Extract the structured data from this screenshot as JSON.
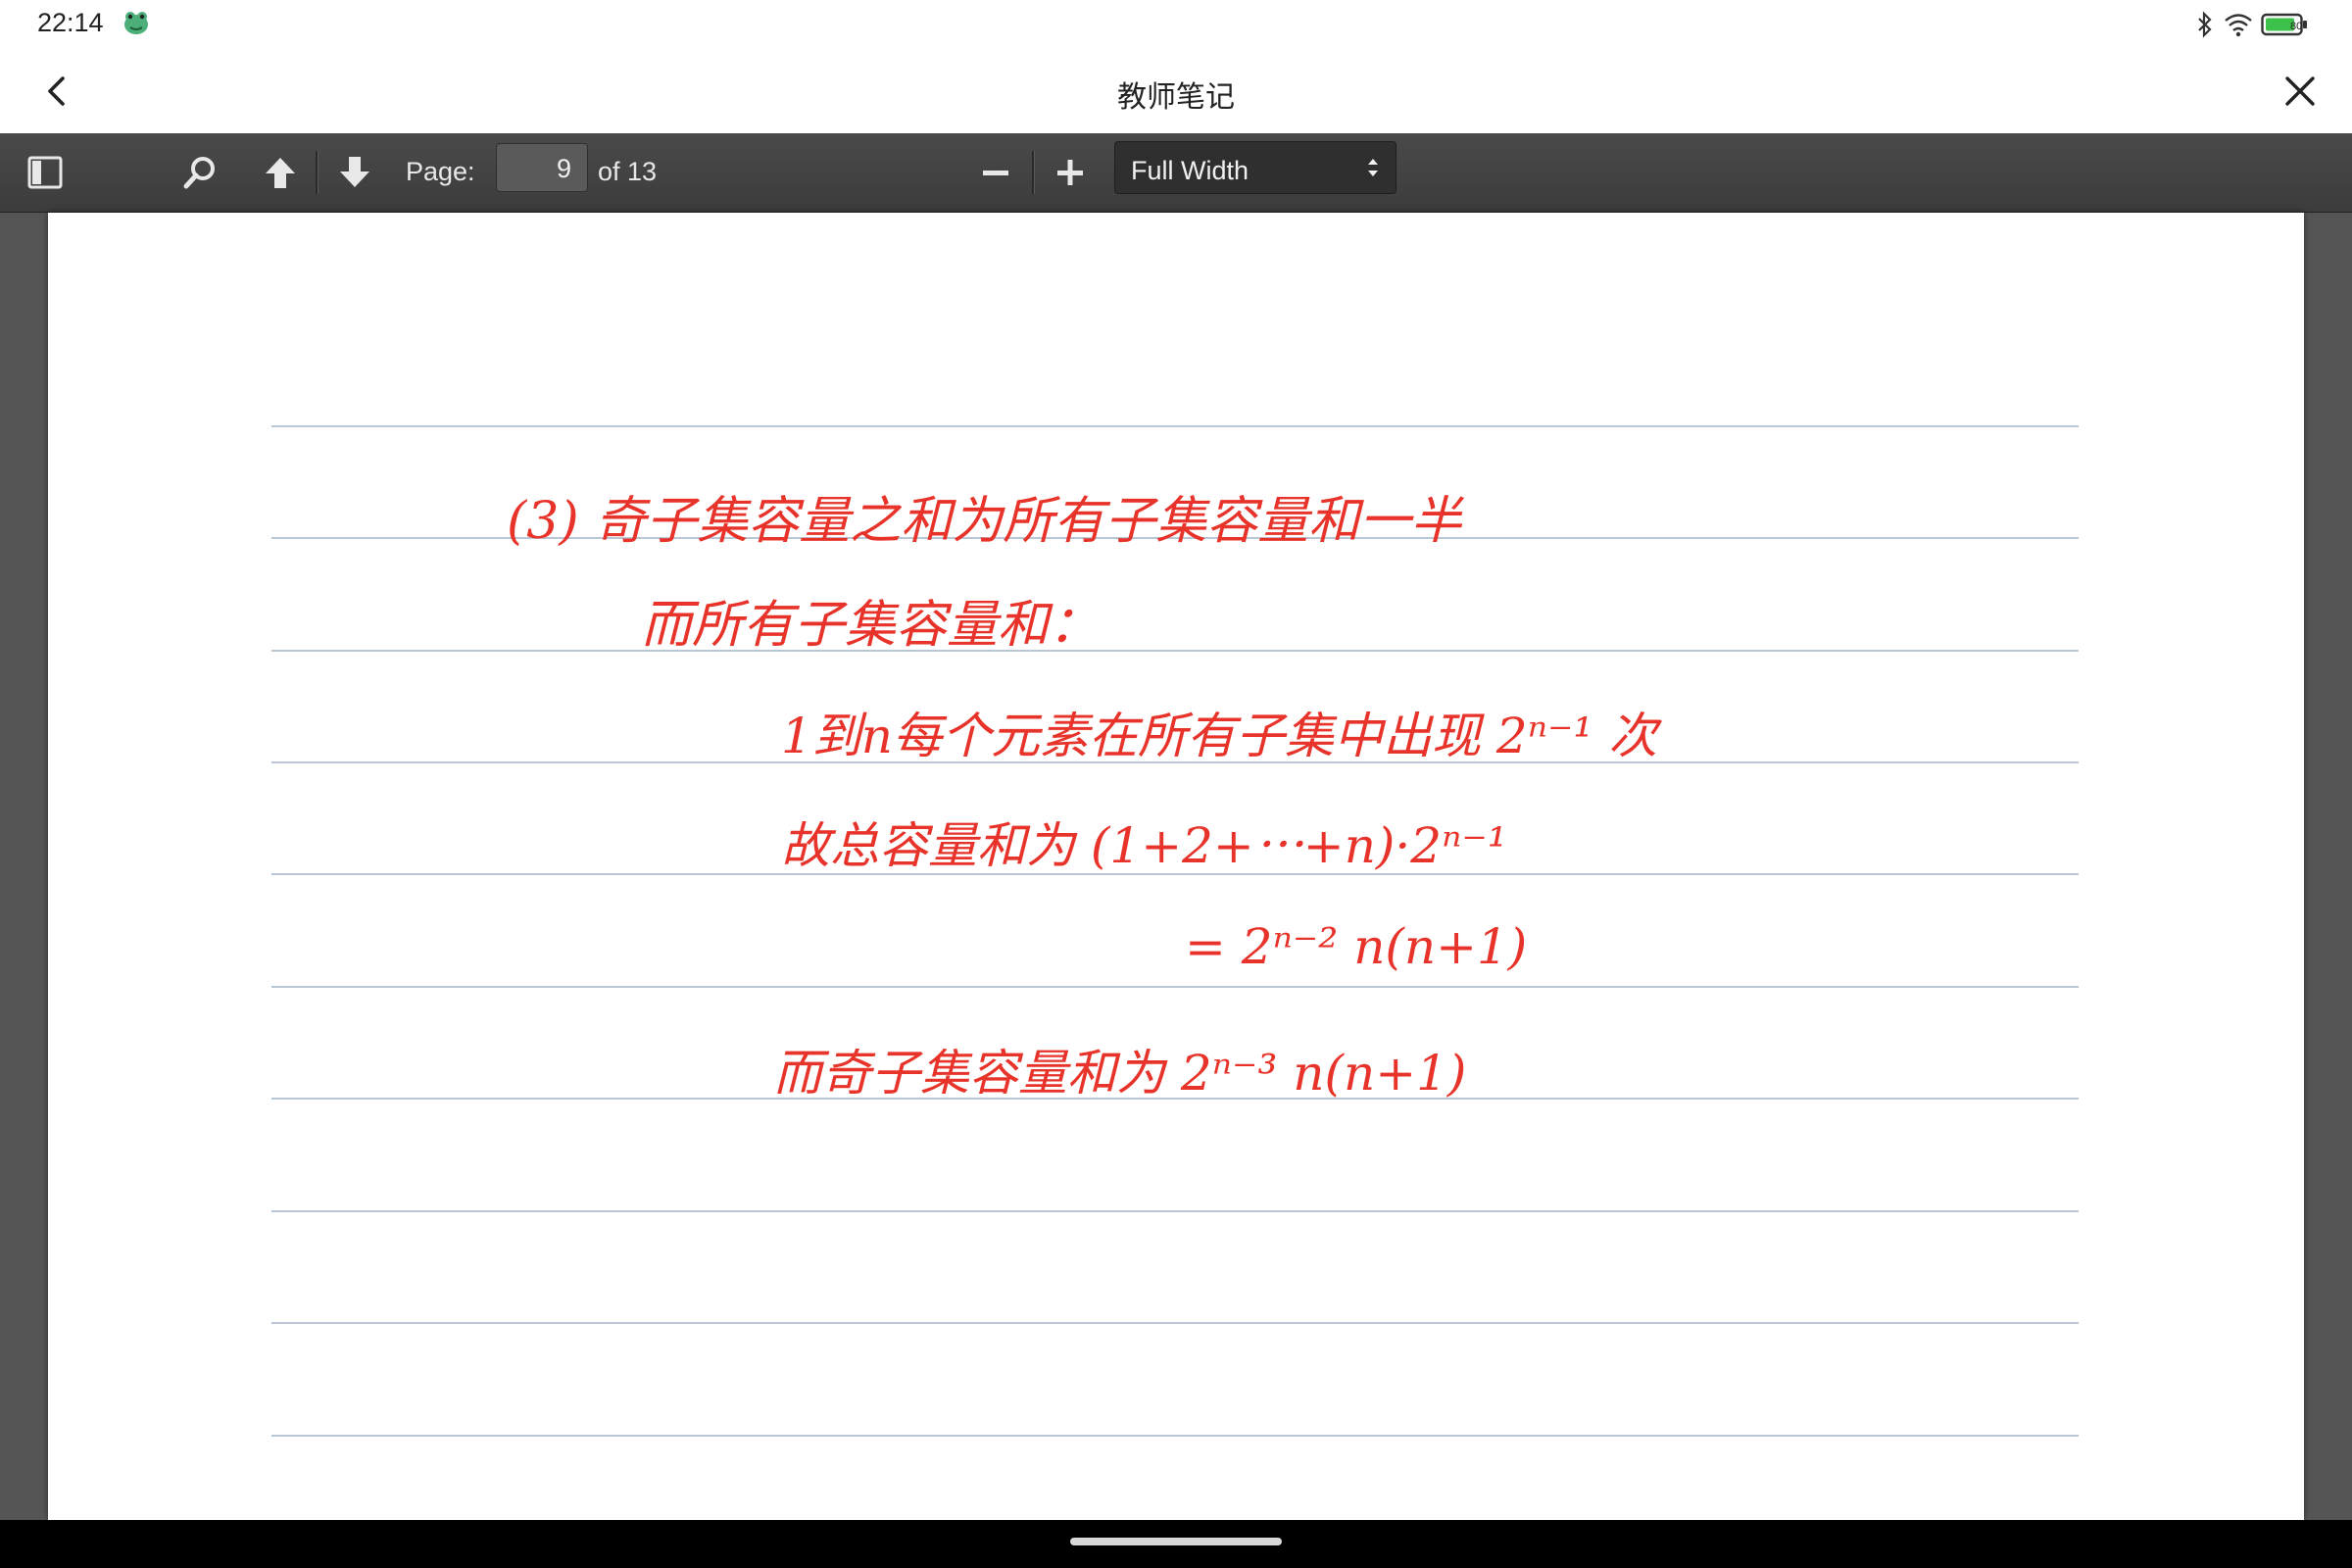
{
  "status_bar": {
    "time": "22:14",
    "app_icon": "frog-app-icon",
    "icons": [
      "bluetooth-icon",
      "wifi-icon",
      "battery-icon"
    ],
    "battery_level": "80"
  },
  "titlebar": {
    "title": "教师笔记",
    "back_icon": "back-chevron-icon",
    "close_icon": "close-icon"
  },
  "toolbar": {
    "sidebar_icon": "sidebar-toggle-icon",
    "search_icon": "search-icon",
    "prev_icon": "arrow-up-icon",
    "next_icon": "arrow-down-icon",
    "page_label": "Page:",
    "page_value": "9",
    "page_count": "of 13",
    "zoom_out_icon": "minus-icon",
    "zoom_in_icon": "plus-icon",
    "zoom_value": "Full Width"
  },
  "document": {
    "page_number": 9,
    "total_pages": 13,
    "ruled_lines": 10,
    "ink_color": "#e8332a",
    "rule_color": "#b8c6d6",
    "lines": [
      "(3) 奇子集容量之和为所有子集容量和一半",
      "而所有子集容量和：",
      "1到n每个元素在所有子集中出现 2ⁿ⁻¹ 次",
      "故总容量和为 (1+2+⋯+n)·2ⁿ⁻¹",
      "= 2ⁿ⁻² n(n+1)",
      "而奇子集容量和为 2ⁿ⁻³ n(n+1)"
    ]
  }
}
